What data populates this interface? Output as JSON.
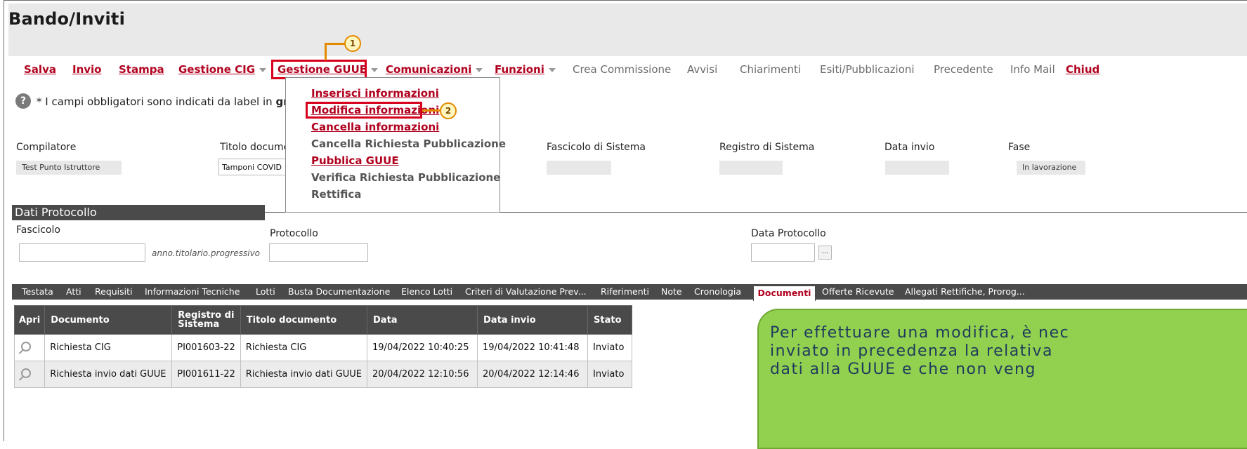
{
  "page": {
    "title": "Bando/Inviti"
  },
  "toolbar": {
    "items": [
      {
        "label": "Salva"
      },
      {
        "label": "Invio"
      },
      {
        "label": "Stampa"
      },
      {
        "label": "Gestione CIG"
      },
      {
        "label": "Gestione GUUE"
      },
      {
        "label": "Comunicazioni"
      },
      {
        "label": "Funzioni"
      },
      {
        "label": "Crea Commissione"
      },
      {
        "label": "Avvisi"
      },
      {
        "label": "Chiarimenti"
      },
      {
        "label": "Esiti/Pubblicazioni"
      },
      {
        "label": "Precedente"
      },
      {
        "label": "Info Mail"
      },
      {
        "label": "Chiud"
      }
    ]
  },
  "callouts": [
    "1",
    "2"
  ],
  "help": {
    "icon": "help-icon",
    "note_prefix": "* I campi obbligatori sono indicati da label in",
    "note_bold": "gras"
  },
  "menu": {
    "items": [
      {
        "label": "Inserisci informazioni"
      },
      {
        "label": "Modifica informazioni"
      },
      {
        "label": "Cancella informazioni"
      },
      {
        "label": "Cancella Richiesta Pubblicazione"
      },
      {
        "label": "Pubblica GUUE"
      },
      {
        "label": "Verifica Richiesta Pubblicazione"
      },
      {
        "label": "Rettifica"
      }
    ]
  },
  "fields": {
    "compilatore": {
      "label": "Compilatore",
      "value": "Test Punto Istruttore"
    },
    "titolo": {
      "label": "Titolo docume",
      "value": "Tamponi COVID"
    },
    "fascicolo_sistema": {
      "label": "Fascicolo di Sistema",
      "value": ""
    },
    "registro_sistema": {
      "label": "Registro di Sistema",
      "value": ""
    },
    "data_invio": {
      "label": "Data invio",
      "value": ""
    },
    "fase": {
      "label": "Fase",
      "value": "In lavorazione"
    }
  },
  "protocollo": {
    "section_title": "Dati Protocollo",
    "fascicolo_label": "Fascicolo",
    "fascicolo_hint": "anno.titolario.progressivo",
    "protocollo_label": "Protocollo",
    "data_label": "Data Protocollo",
    "picker_label": "..."
  },
  "tabs": [
    {
      "label": "Testata"
    },
    {
      "label": "Atti"
    },
    {
      "label": "Requisiti"
    },
    {
      "label": "Informazioni Tecniche"
    },
    {
      "label": "Lotti"
    },
    {
      "label": "Busta Documentazione"
    },
    {
      "label": "Elenco Lotti"
    },
    {
      "label": "Criteri di Valutazione Prev..."
    },
    {
      "label": "Riferimenti"
    },
    {
      "label": "Note"
    },
    {
      "label": "Cronologia"
    },
    {
      "label": "Documenti"
    },
    {
      "label": "Offerte Ricevute"
    },
    {
      "label": "Allegati Rettifiche, Prorog..."
    }
  ],
  "documents": {
    "headers": [
      "Apri",
      "Documento",
      "Registro di Sistema",
      "Titolo documento",
      "Data",
      "Data invio",
      "Stato"
    ],
    "rows": [
      {
        "documento": "Richiesta CIG",
        "registro": "PI001603-22",
        "titolo": "Richiesta CIG",
        "data": "19/04/2022 10:40:25",
        "data_invio": "19/04/2022 10:41:48",
        "stato": "Inviato"
      },
      {
        "documento": "Richiesta invio dati GUUE",
        "registro": "PI001611-22",
        "titolo": "Richiesta invio dati GUUE",
        "data": "20/04/2022 12:10:56",
        "data_invio": "20/04/2022 12:14:46",
        "stato": "Inviato"
      }
    ]
  },
  "callout_note": {
    "line1": "Per effettuare una modifica, è nec",
    "line2": "inviato in precedenza la relativa",
    "line3": "dati alla GUUE e che non veng"
  },
  "colors": {
    "accent": "#b0001e",
    "highlight": "#d6001c",
    "callout": "#e38a00",
    "note_bg": "#92d050",
    "bar": "#4a4a4a"
  }
}
